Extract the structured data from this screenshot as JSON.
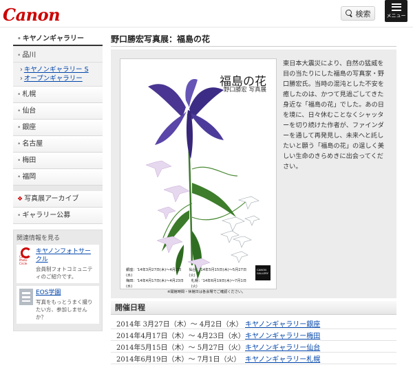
{
  "header": {
    "logo": "Canon",
    "search_label": "検索",
    "menu_label": "メニュー"
  },
  "sidebar": {
    "heading": "キヤノンギャラリー",
    "shinagawa": {
      "label": "品川",
      "links": [
        "キヤノンギャラリー S",
        "オープンギャラリー"
      ]
    },
    "cities": [
      "札幌",
      "仙台",
      "銀座",
      "名古屋",
      "梅田",
      "福岡"
    ],
    "archive": "写真展アーカイブ",
    "recruit": "ギャラリー公募",
    "related": {
      "title": "関連情報を見る",
      "items": [
        {
          "link": "キヤノンフォトサークル",
          "desc": "会員制フォトコミュニティのご紹介です。",
          "logo_text": "Canon Photo Circle"
        },
        {
          "link": "EOS学園",
          "desc": "写真をもっとうまく撮りたい方、参加しませんか？"
        }
      ]
    }
  },
  "main": {
    "title": "野口勝宏写真展：福島の花",
    "poster": {
      "title": "福島の花",
      "subtitle": "野口勝宏 写真展",
      "dates": [
        "銀座：'14年3月27日(木)〜4月2日(水)",
        "仙台：'14年5月15日(木)〜5月27日(火)",
        "梅田：'14年4月17日(木)〜4月23日(水)",
        "札幌：'14年6月19日(木)〜7月1日(火)"
      ],
      "note": "※開館時間・休館日は各会場でご確認ください。",
      "badge": "CANON GALLERY"
    },
    "description": "東日本大震災により、自然の猛威を目の当たりにした福島の写真家・野口勝宏氏。当時の混沌とした不安を癒したのは、かつて見過ごしてきた身近な「福島の花」でした。あの日を境に、日々休むことなくシャッターを切り続けた作者が、ファインダーを通して再発見し、未来へと託したいと願う「福島の花」の逞しく美しい生命のきらめきに出会ってください。",
    "schedule_title": "開催日程",
    "schedule": [
      {
        "date": "2014年 3月27日（木）～ 4月2日（水）",
        "venue": "キヤノンギャラリー銀座"
      },
      {
        "date": "2014年4月17日（木）～ 4月23日（水）",
        "venue": "キヤノンギャラリー梅田"
      },
      {
        "date": "2014年5月15日（木）～ 5月27日（火）",
        "venue": "キヤノンギャラリー仙台"
      },
      {
        "date": "2014年6月19日（木）～ 7月1日（火）",
        "venue": "キヤノンギャラリー札幌"
      }
    ]
  },
  "colors": {
    "brand": "#cc0000",
    "link": "#0044aa"
  }
}
